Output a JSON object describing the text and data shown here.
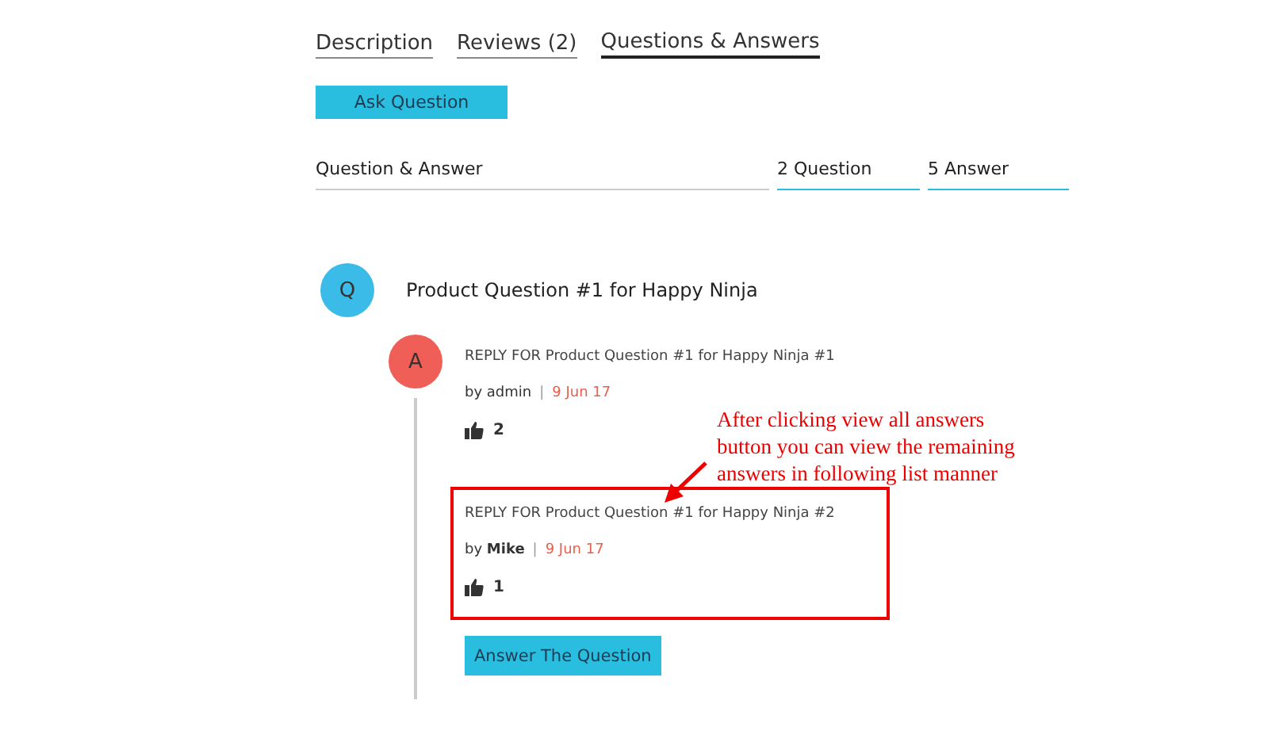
{
  "tabs": [
    {
      "label": "Description",
      "selected": false
    },
    {
      "label": "Reviews (2)",
      "selected": false
    },
    {
      "label": "Questions & Answers",
      "selected": true
    }
  ],
  "ask_button": "Ask Question",
  "summary": {
    "title": "Question & Answer",
    "questions": "2 Question",
    "answers": "5 Answer"
  },
  "question": {
    "badge": "Q",
    "text": "Product Question #1 for Happy Ninja"
  },
  "answer_badge": "A",
  "answers": [
    {
      "text": "REPLY FOR Product Question #1 for Happy Ninja #1",
      "byline": "by admin",
      "separator": "|",
      "date": "9 Jun 17",
      "likes": "2",
      "highlighted": false
    },
    {
      "text": "REPLY FOR Product Question #1 for Happy Ninja #2",
      "byline": "by **Mike**",
      "separator": "|",
      "date": "9 Jun 17",
      "likes": "1",
      "highlighted": true
    }
  ],
  "answer_button": "Answer The Question",
  "annotation": "After clicking view all answers button you can view the remaining answers in following list manner"
}
